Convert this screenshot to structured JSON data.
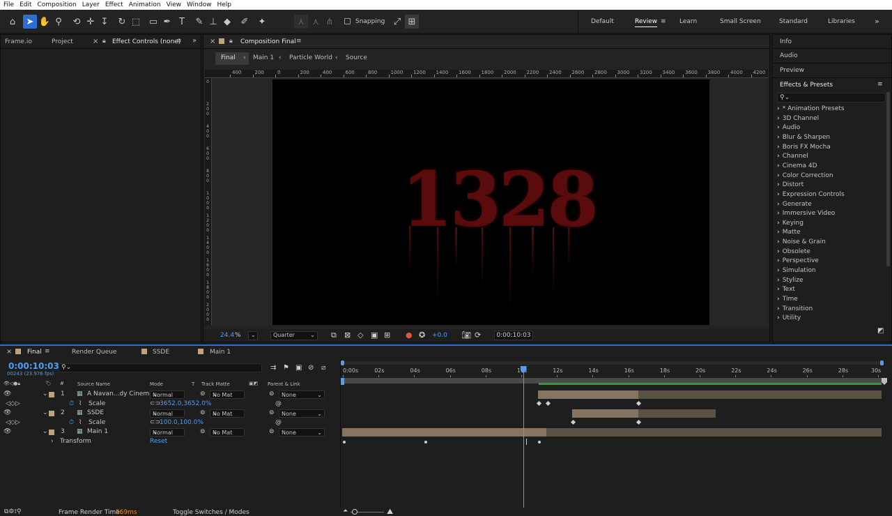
{
  "menu": [
    "File",
    "Edit",
    "Composition",
    "Layer",
    "Effect",
    "Animation",
    "View",
    "Window",
    "Help"
  ],
  "toolbar": {
    "snapping_label": "Snapping"
  },
  "workspaces": [
    "Default",
    "Review",
    "Learn",
    "Small Screen",
    "Standard",
    "Libraries"
  ],
  "workspace_more": "»",
  "left_panel": {
    "tabs": [
      "Frame.io",
      "Project",
      "Effect Controls (none)"
    ]
  },
  "comp_panel": {
    "tab": "Composition Final",
    "breadcrumbs": [
      "Final",
      "Main 1",
      "Particle World",
      "Source"
    ],
    "ruler_h": [
      "400",
      "200",
      "0",
      "200",
      "400",
      "600",
      "800",
      "1000",
      "1200",
      "1400",
      "1600",
      "1800",
      "2000",
      "2200",
      "2400",
      "2600",
      "2800",
      "3000",
      "3200",
      "3400",
      "3600",
      "3800",
      "4000",
      "4200"
    ],
    "ruler_v": [
      "0",
      "200",
      "400",
      "600",
      "800",
      "1000",
      "1200",
      "1400",
      "1600",
      "1800",
      "2000"
    ],
    "preview_text": "1328",
    "zoom": "24.4",
    "zoom_unit": "%",
    "resolution": "Quarter",
    "exposure": "+0.0",
    "timecode": "0:00:10:03"
  },
  "right_panel": {
    "sections": [
      "Info",
      "Audio",
      "Preview",
      "Effects & Presets"
    ],
    "search_placeholder": "",
    "categories": [
      "* Animation Presets",
      "3D Channel",
      "Audio",
      "Blur & Sharpen",
      "Boris FX Mocha",
      "Channel",
      "Cinema 4D",
      "Color Correction",
      "Distort",
      "Expression Controls",
      "Generate",
      "Immersive Video",
      "Keying",
      "Matte",
      "Noise & Grain",
      "Obsolete",
      "Perspective",
      "Simulation",
      "Stylize",
      "Text",
      "Time",
      "Transition",
      "Utility"
    ]
  },
  "timeline": {
    "tabs": [
      "Final",
      "Render Queue",
      "SSDE",
      "Main 1"
    ],
    "timecode": "0:00:10:03",
    "fps": "00243 (23.976 fps)",
    "columns": {
      "source_name": "Source Name",
      "mode": "Mode",
      "t": "T",
      "track_matte": "Track Matte",
      "parent": "Parent & Link"
    },
    "layers": [
      {
        "num": "1",
        "name": "A Navan...dy Cinema",
        "mode": "Normal",
        "matte": "No Mat",
        "parent": "None",
        "prop": "Scale",
        "value": "3652.0,3652.0%"
      },
      {
        "num": "2",
        "name": "SSDE",
        "mode": "Normal",
        "matte": "No Mat",
        "parent": "None",
        "prop": "Scale",
        "value": "100.0,100.0%"
      },
      {
        "num": "3",
        "name": "Main 1",
        "mode": "Normal",
        "matte": "No Mat",
        "parent": "None",
        "prop": "Transform",
        "value": "Reset"
      }
    ],
    "ticks": [
      "0:00s",
      "02s",
      "04s",
      "06s",
      "08s",
      "10s",
      "12s",
      "14s",
      "16s",
      "18s",
      "20s",
      "22s",
      "24s",
      "26s",
      "28s",
      "30s"
    ],
    "playhead_seconds": 10.1
  },
  "status": {
    "render_label": "Frame Render Time:",
    "render_time": "569ms",
    "toggle_label": "Toggle Switches / Modes"
  }
}
